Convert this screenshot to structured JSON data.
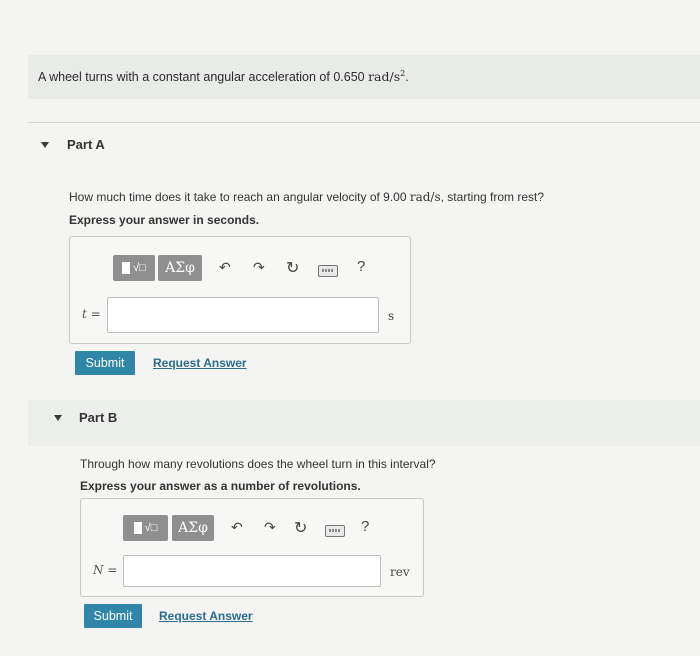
{
  "problem": {
    "text": "A wheel turns with a constant angular acceleration of 0.650",
    "unit": "rad/s",
    "exp": "2",
    "end": "."
  },
  "partA": {
    "title": "Part A",
    "question_pre": "How much time does it take to reach an angular velocity of 9.00",
    "question_unit": "rad/s",
    "question_post": ", starting from rest?",
    "instruction": "Express your answer in seconds.",
    "symbol": "ΣΦ",
    "greek": "ΑΣφ",
    "var_label": "t =",
    "unit": "s",
    "value": "",
    "submit": "Submit",
    "request": "Request Answer"
  },
  "partB": {
    "title": "Part B",
    "question": "Through how many revolutions does the wheel turn in this interval?",
    "instruction": "Express your answer as a number of revolutions.",
    "greek": "ΑΣφ",
    "var_label": "N =",
    "unit": "rev",
    "value": "",
    "submit": "Submit",
    "request": "Request Answer"
  },
  "toolbar": {
    "help": "?"
  }
}
